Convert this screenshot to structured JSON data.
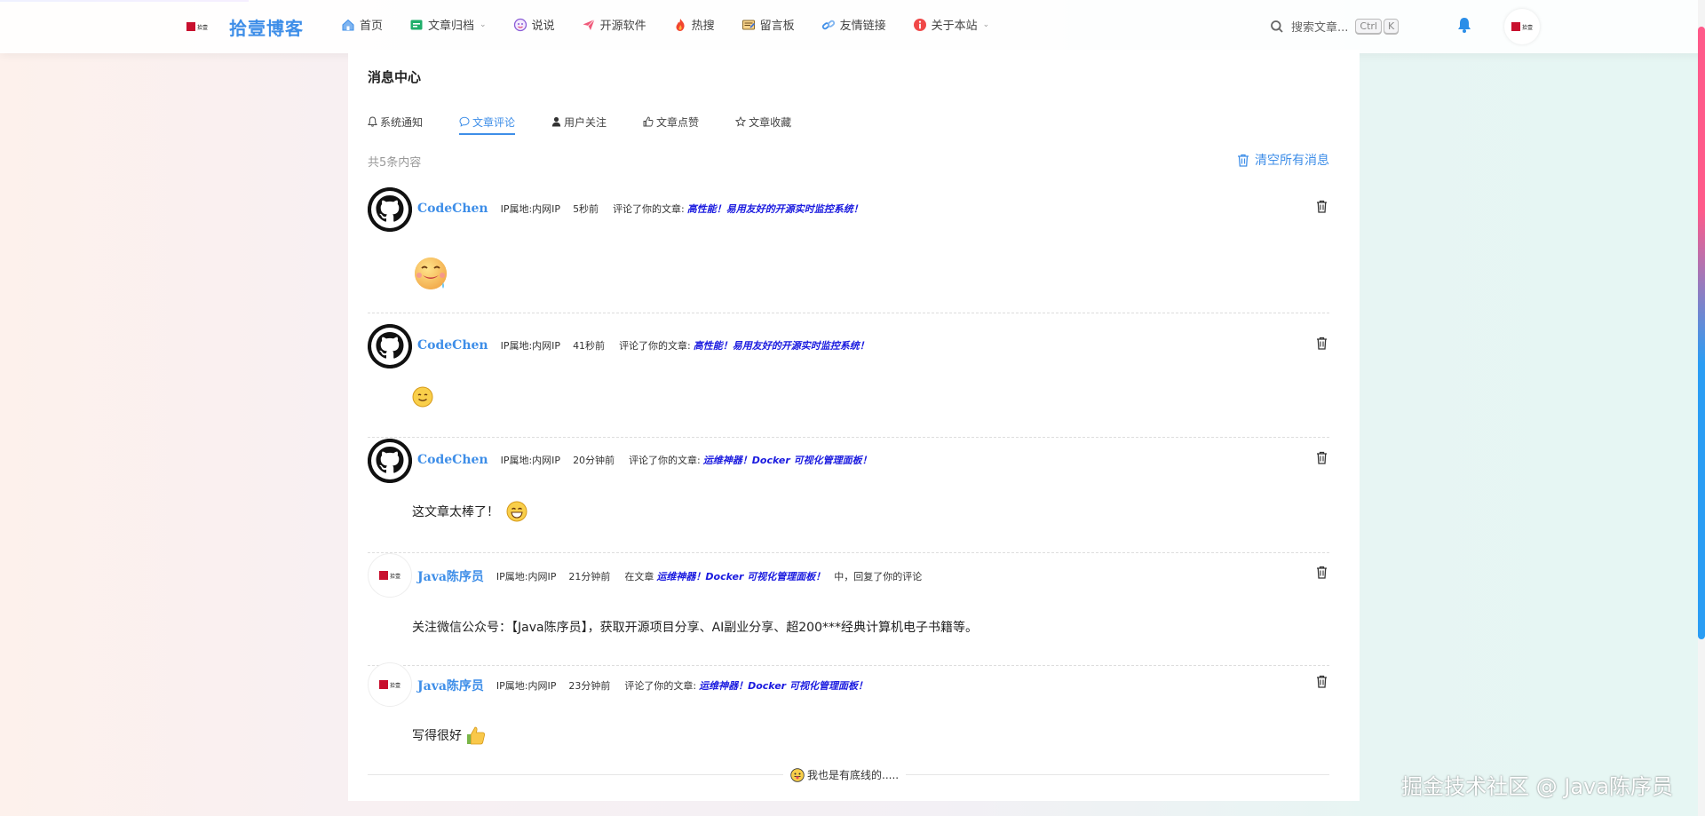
{
  "header": {
    "brand_title": "拾壹博客",
    "logo_text": "拾壹",
    "nav": [
      {
        "label": "首页",
        "icon": "home-icon"
      },
      {
        "label": "文章归档",
        "icon": "archive-icon",
        "dropdown": true
      },
      {
        "label": "说说",
        "icon": "chat-face-icon"
      },
      {
        "label": "开源软件",
        "icon": "paper-plane-icon"
      },
      {
        "label": "热搜",
        "icon": "fire-icon"
      },
      {
        "label": "留言板",
        "icon": "message-board-icon"
      },
      {
        "label": "友情链接",
        "icon": "link-icon"
      },
      {
        "label": "关于本站",
        "icon": "info-icon",
        "dropdown": true
      }
    ],
    "search_placeholder": "搜索文章...",
    "kbd_ctrl": "Ctrl",
    "kbd_k": "K"
  },
  "panel": {
    "title": "消息中心",
    "tabs": [
      {
        "label": "系统通知",
        "icon": "bell-icon",
        "active": false
      },
      {
        "label": "文章评论",
        "icon": "comment-icon",
        "active": true
      },
      {
        "label": "用户关注",
        "icon": "user-icon",
        "active": false
      },
      {
        "label": "文章点赞",
        "icon": "thumbs-up-icon",
        "active": false
      },
      {
        "label": "文章收藏",
        "icon": "star-icon",
        "active": false
      }
    ],
    "total_text": "共5条内容",
    "clear_all_label": "清空所有消息"
  },
  "messages": [
    {
      "name": "CodeChen",
      "ip": "IP属地:内网IP",
      "time": "5秒前",
      "action": "评论了你的文章:",
      "article": "高性能！易用友好的开源实时监控系统！",
      "suffix": "",
      "content": "",
      "emoji": "drooling-face"
    },
    {
      "name": "CodeChen",
      "ip": "IP属地:内网IP",
      "time": "41秒前",
      "action": "评论了你的文章:",
      "article": "高性能！易用友好的开源实时监控系统！",
      "suffix": "",
      "content": "",
      "emoji": "smiling-face"
    },
    {
      "name": "CodeChen",
      "ip": "IP属地:内网IP",
      "time": "20分钟前",
      "action": "评论了你的文章:",
      "article": "运维神器！Docker 可视化管理面板！",
      "suffix": "",
      "content": "这文章太棒了！",
      "emoji": "grinning-face"
    },
    {
      "name": "Java陈序员",
      "ip": "IP属地:内网IP",
      "time": "21分钟前",
      "action": "在文章",
      "article": "运维神器！Docker 可视化管理面板！",
      "suffix": "中，回复了你的评论",
      "content": "关注微信公众号：【Java陈序员】，获取开源项目分享、AI副业分享、超200***经典计算机电子书籍等。",
      "emoji": ""
    },
    {
      "name": "Java陈序员",
      "ip": "IP属地:内网IP",
      "time": "23分钟前",
      "action": "评论了你的文章:",
      "article": "运维神器！Docker 可视化管理面板！",
      "suffix": "",
      "content": "写得很好",
      "emoji": "thumbs-up"
    }
  ],
  "footer_text": "我也是有底线的.....",
  "watermark": "掘金技术社区 @ Java陈序员",
  "colors": {
    "accent": "#3e8ee8",
    "article_link": "#1a1adf"
  }
}
